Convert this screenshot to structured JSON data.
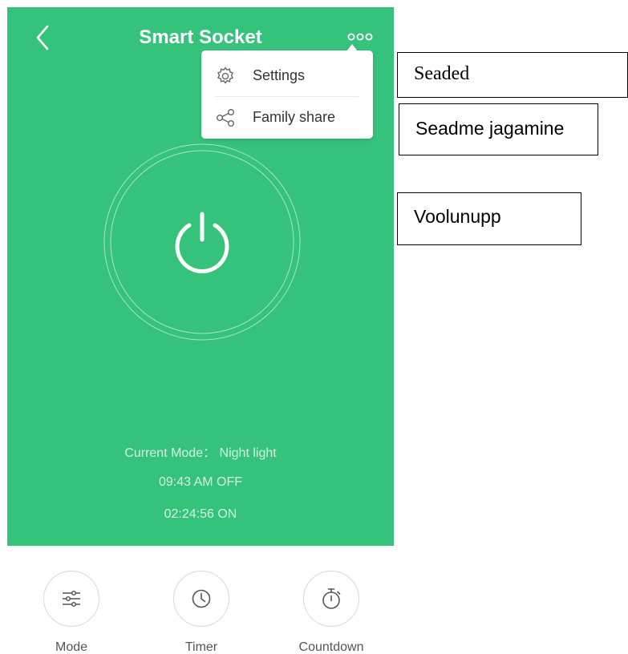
{
  "header": {
    "title": "Smart Socket"
  },
  "menu": {
    "items": [
      {
        "label": "Settings",
        "icon": "gear-icon"
      },
      {
        "label": "Family share",
        "icon": "share-icon"
      }
    ]
  },
  "status": {
    "mode": "Current Mode： Night light",
    "schedule": "09:43 AM  OFF",
    "countdown": "02:24:56 ON"
  },
  "controls": [
    {
      "label": "Mode",
      "icon": "sliders-icon"
    },
    {
      "label": "Timer",
      "icon": "clock-icon"
    },
    {
      "label": "Countdown",
      "icon": "stopwatch-icon"
    }
  ],
  "annotations": {
    "settings": "Seaded",
    "share": "Seadme jagamine",
    "power": "Voolunupp"
  },
  "colors": {
    "accent_green": "#35c37c",
    "white": "#ffffff"
  }
}
